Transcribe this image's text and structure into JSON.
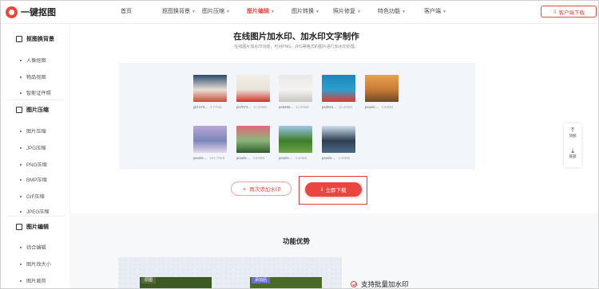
{
  "header": {
    "logo_text": "一键抠图",
    "nav": [
      {
        "label": "首页",
        "has_menu": false,
        "active": false
      },
      {
        "label": "抠图换背景",
        "has_menu": true,
        "active": false
      },
      {
        "label": "图片压缩",
        "has_menu": true,
        "active": false
      },
      {
        "label": "图片编辑",
        "has_menu": true,
        "active": true
      },
      {
        "label": "图片转换",
        "has_menu": true,
        "active": false
      },
      {
        "label": "照片修复",
        "has_menu": true,
        "active": false
      },
      {
        "label": "特色功能",
        "has_menu": true,
        "active": false
      },
      {
        "label": "客户端",
        "has_menu": true,
        "active": false
      }
    ],
    "download_client_label": "客户端下载",
    "accent": "#e9463f"
  },
  "sidebar": {
    "sections": [
      {
        "title": "抠图换背景",
        "items": [
          "人像抠图",
          "物品抠图",
          "智能证件照"
        ]
      },
      {
        "title": "图片压缩",
        "items": [
          "图片压缩",
          "JPG压缩",
          "PNG压缩",
          "BMP压缩",
          "GIF压缩",
          "JPEG压缩"
        ]
      },
      {
        "title": "图片编辑",
        "items": [
          "综合编辑",
          "图片改大小",
          "图片裁剪"
        ]
      }
    ]
  },
  "main": {
    "title": "在线图片加水印、加水印文字制作",
    "subtitle": "在线图片加水印功能，可对PNG、JPG等格式的图片进行加水印处理。",
    "images": [
      {
        "name": "girl-276...",
        "size": "4.77MB",
        "colors": [
          "#2b4a6b",
          "#c84b3a",
          "#e9e0d6"
        ]
      },
      {
        "name": "pe7074...",
        "size": "10.29MB",
        "colors": [
          "#f4efe6",
          "#d0342c",
          "#e8e2d8"
        ]
      },
      {
        "name": "pe5450...",
        "size": "13.00MB",
        "colors": [
          "#eae8e6",
          "#c9c3bd",
          "#f5f3f1"
        ]
      },
      {
        "name": "pe3041...",
        "size": "10.49MB",
        "colors": [
          "#1d86b8",
          "#e23a33",
          "#2b9fcf"
        ]
      },
      {
        "name": "pexels-...",
        "size": "3.59MB",
        "colors": [
          "#e8a24e",
          "#6b4a2a",
          "#c97a34"
        ]
      },
      {
        "name": "pexels-...",
        "size": "281.75KB",
        "colors": [
          "#b9a7d6",
          "#e7d7ee",
          "#7a86b8"
        ]
      },
      {
        "name": "pexels-...",
        "size": "3.65MB",
        "colors": [
          "#e06a7a",
          "#2e5b2c",
          "#8ab67a"
        ]
      },
      {
        "name": "pexels-...",
        "size": "3.62MB",
        "colors": [
          "#9fc7e8",
          "#6aa54a",
          "#3f7d2c"
        ]
      },
      {
        "name": "pexels-...",
        "size": "2.08MB",
        "colors": [
          "#cfe0ee",
          "#4b6b8a",
          "#2f3f52"
        ]
      }
    ],
    "add_again_label": "再次添加水印",
    "download_now_label": "立即下载"
  },
  "features": {
    "section_title": "功能优势",
    "card_left_tag": "原图",
    "card_right_tag": "添加后",
    "feature_1": "支持批量加水印"
  },
  "float_panel": {
    "top_label": "顶部",
    "bottom_label": "底部"
  }
}
